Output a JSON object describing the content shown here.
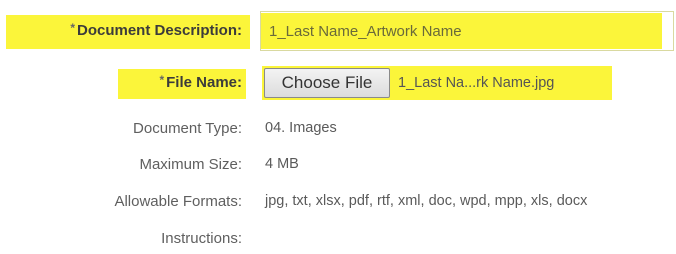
{
  "form": {
    "required_mark": "*",
    "description": {
      "label": "Document Description:",
      "value": "1_Last Name_Artwork Name"
    },
    "file": {
      "label": "File Name:",
      "button_label": "Choose File",
      "selected_file": "1_Last Na...rk Name.jpg"
    },
    "document_type": {
      "label": "Document Type:",
      "value": "04. Images"
    },
    "maximum_size": {
      "label": "Maximum Size:",
      "value": "4 MB"
    },
    "allowable_formats": {
      "label": "Allowable Formats:",
      "value": "jpg, txt, xlsx, pdf, rtf, xml, doc, wpd, mpp, xls, docx"
    },
    "instructions": {
      "label": "Instructions:",
      "value": ""
    }
  },
  "colors": {
    "highlight": "#fbf53a"
  }
}
